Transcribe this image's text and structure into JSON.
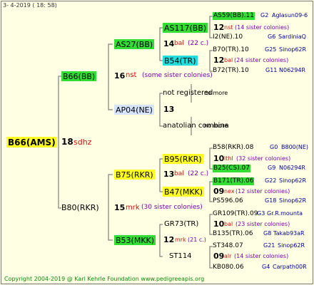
{
  "header_date": "3-  4-2019  ( 18:  58)",
  "copyright": "Copyright 2004-2019 @ Karl Kehrle Foundation   www.pedigreeapis.org",
  "root": {
    "name": "B66(AMS)",
    "num": "18",
    "note": "sdhz"
  },
  "g1_top": {
    "name": "B66(BB)",
    "num": "16",
    "code": "nst",
    "note": "(some sister colonies)"
  },
  "g1_bot": {
    "name": "B80(RKR)",
    "num": "15",
    "code": "mrk",
    "note": "(30 sister colonies)"
  },
  "g2": {
    "as27": {
      "name": "AS27(BB)",
      "num": "14",
      "code": "bal",
      "note": "(22 c.)"
    },
    "ap04": {
      "name": "AP04(NE)",
      "num": "13"
    },
    "b75": {
      "name": "B75(RKR)",
      "num": "13",
      "code": "bal",
      "note": "(22 c.)"
    },
    "b53": {
      "name": "B53(MKK)",
      "num": "12",
      "code": "mrk",
      "note": "(21 c.)"
    }
  },
  "g3": {
    "as117": {
      "name": "AS117(BB)",
      "num": "12",
      "code": "nst",
      "note": "(14 sister colonies)"
    },
    "b54": {
      "name": "B54(TR)",
      "num": "12",
      "code": "bal",
      "note": "(24 sister colonies)"
    },
    "notreg": {
      "name": "not registered",
      "more": "no more"
    },
    "anat": {
      "name": "anatolian combina",
      "more": "no more"
    },
    "b95": {
      "name": "B95(RKR)",
      "num": "10",
      "code": "lthl",
      "note": "(32 sister colonies)"
    },
    "b47": {
      "name": "B47(MKK)",
      "num": "09",
      "code": "nex",
      "note": "(12 sister colonies)"
    },
    "gr73": {
      "name": "GR73(TR)",
      "num": "10",
      "code": "bal",
      "note": "(23 sister colonies)"
    },
    "st114": {
      "name": "ST114",
      "num": "09",
      "code": "alr",
      "note": "(14 sister colonies)"
    }
  },
  "g4": [
    {
      "name": "AS59(BB).11",
      "gen": "G2",
      "place": "Aglasun09-6"
    },
    {
      "name": "I2(NE).10",
      "gen": "G6",
      "place": "SardiniaQ"
    },
    {
      "name": "B70(TR).10",
      "gen": "G25",
      "place": "Sinop62R"
    },
    {
      "name": "B72(TR).10",
      "gen": "G11",
      "place": "N06294R"
    },
    {
      "name": "B58(RKR).08",
      "gen": "G0",
      "place": "B800(NE)"
    },
    {
      "name": "B25(CS).07",
      "gen": "G9",
      "place": "N06294R"
    },
    {
      "name": "B171(TR).06",
      "gen": "G22",
      "place": "Sinop62R"
    },
    {
      "name": "PS596.06",
      "gen": "G18",
      "place": "Sinop62R"
    },
    {
      "name": "GR109(TR).09",
      "gen": "G3",
      "place": "Gr.R.mounta"
    },
    {
      "name": "B135(TR).06",
      "gen": "G8",
      "place": "Takab93aR"
    },
    {
      "name": "ST348.07",
      "gen": "G21",
      "place": "Sinop62R"
    },
    {
      "name": "KB080.06",
      "gen": "G4",
      "place": "Carpath00R"
    }
  ]
}
